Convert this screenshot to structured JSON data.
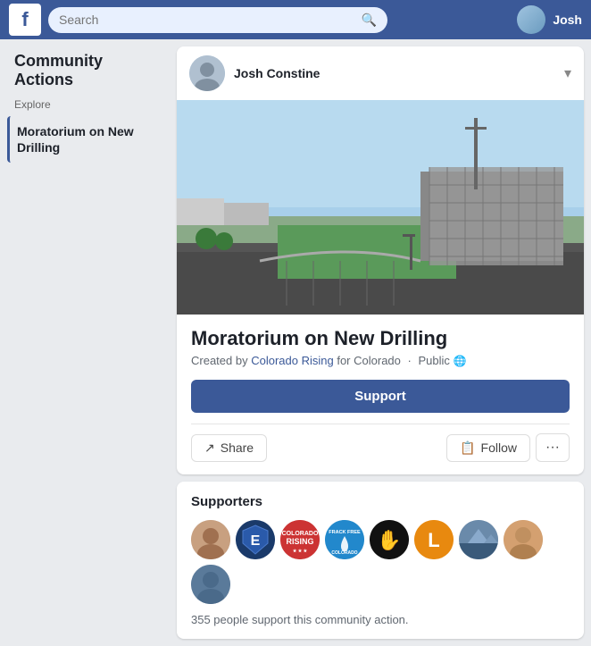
{
  "nav": {
    "logo": "f",
    "search_placeholder": "Search",
    "username": "Josh"
  },
  "sidebar": {
    "title": "Community Actions",
    "explore_label": "Explore",
    "active_item": "Moratorium on New Drilling"
  },
  "post": {
    "author": "Josh Constine",
    "chevron": "▾"
  },
  "action": {
    "title": "Moratorium on New Drilling",
    "created_by_label": "Created by",
    "creator": "Colorado Rising",
    "for": "for Colorado",
    "visibility": "Public",
    "support_button": "Support",
    "share_button": "Share",
    "follow_button": "Follow"
  },
  "supporters": {
    "title": "Supporters",
    "count_text": "355 people support this community action.",
    "avatars": [
      {
        "label": "",
        "class": "av1"
      },
      {
        "label": "E",
        "class": "av2"
      },
      {
        "label": "CR",
        "class": "av3"
      },
      {
        "label": "FF",
        "class": "av4"
      },
      {
        "label": "🤚",
        "class": "av5"
      },
      {
        "label": "L",
        "class": "av6"
      },
      {
        "label": "",
        "class": "av7"
      },
      {
        "label": "",
        "class": "av8"
      },
      {
        "label": "",
        "class": "av9"
      }
    ]
  },
  "icons": {
    "search": "🔍",
    "share": "↗",
    "follow": "📋",
    "more": "•••",
    "globe": "🌐"
  }
}
